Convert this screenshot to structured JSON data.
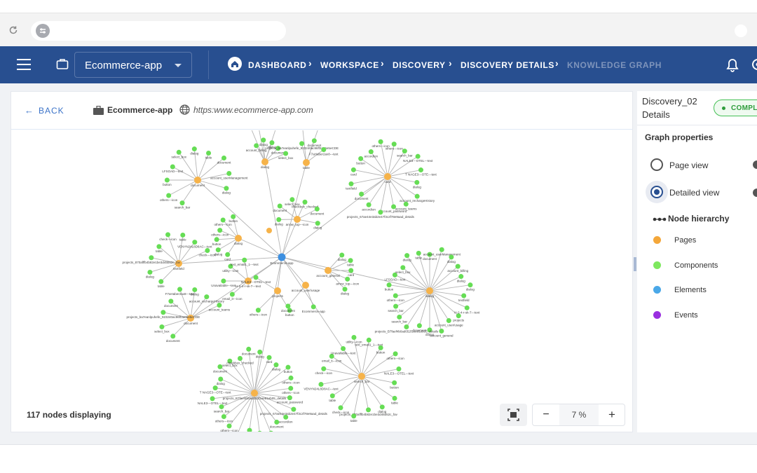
{
  "app_bar": {
    "app_select": "Ecommerce-app",
    "breadcrumbs": [
      "DASHBOARD",
      "WORKSPACE",
      "DISCOVERY",
      "DISCOVERY DETAILS",
      "KNOWLEDGE GRAPH"
    ]
  },
  "card": {
    "back_label": "BACK",
    "project_name": "Ecommerce-app",
    "url": "https:www.ecommerce-app.com",
    "nodes_count": "117 nodes displaying",
    "zoom_minus": "−",
    "zoom_value": "7 %",
    "zoom_plus": "+"
  },
  "side": {
    "title_line1": "Discovery_02",
    "title_line2": "Details",
    "status": "COMPLI",
    "graph_properties": "Graph properties",
    "page_view": "Page view",
    "detailed_view": "Detailed view",
    "selected_view": "Detailed view",
    "node_hierarchy": "Node hierarchy",
    "legend": [
      {
        "label": "Pages",
        "color": "#f4a73a"
      },
      {
        "label": "Components",
        "color": "#7ee85f"
      },
      {
        "label": "Elements",
        "color": "#4aa8e8"
      },
      {
        "label": "Events",
        "color": "#9a2fe0"
      }
    ]
  },
  "graph": {
    "colors": {
      "page": "#f6b34a",
      "component": "#66dd55",
      "root": "#3d8fe0",
      "edge": "#b4b4b4"
    },
    "root": {
      "label": "Ecommerce-app"
    },
    "labels": [
      "document",
      "dialog",
      "table",
      "card",
      "arrow_top---icon",
      "dialog",
      "textfield",
      "H-2-4-r-sk-7---text",
      "projects",
      "account_user/usage",
      "account_general",
      "dialog",
      "document",
      "projects_B7faef4b0ad052f1ee81eb05_details",
      "search_bar",
      "search_bar",
      "others---icon",
      "button",
      "LFSOAD---text",
      "select_box",
      "dialog",
      "table",
      "document",
      "account_userManagement",
      "dialog",
      "account_billing",
      "dialog",
      "dialog",
      "document",
      "select_box",
      "projects_ba7eanlpuhefe_923240ac96ff3a06e5eCDE",
      "document",
      "F7aHaber2ax8---text",
      "dialog",
      "account_rechargeHistory",
      "account_teams",
      "account_password",
      "projects_67ae44e3ab2e47f3c2f78e9aad_details",
      "accordion",
      "document",
      "textfield",
      "card",
      "button",
      "accordion",
      "others---icon",
      "others---icon",
      "search_bar",
      "NALE3---OTEL---text",
      "T NAGE3---OTE---text",
      "dialog",
      "document",
      "select_box",
      "checkbox_checked",
      "document",
      "dialog",
      "card",
      "dialog",
      "button",
      "others---icon",
      "others---icon",
      "button",
      "table",
      "dialog",
      "projects_870afffb4b82e1be3d45b52c_fav",
      "table",
      "check---icon",
      "table",
      "VENYN24L8D8AC---text",
      "check---icon",
      "email_it---icon",
      "Unavailable---text",
      "utility---icon",
      "text_email1_1---text",
      "button",
      "others---icon",
      "NALE3---OTEL---text",
      "Ecommerce-app"
    ]
  }
}
